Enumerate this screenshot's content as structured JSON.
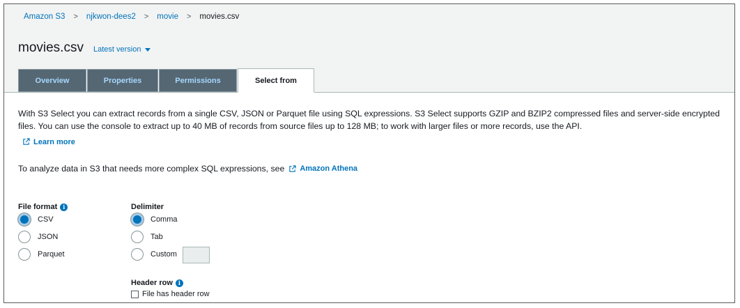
{
  "breadcrumb": {
    "items": [
      "Amazon S3",
      "njkwon-dees2",
      "movie"
    ],
    "current": "movies.csv",
    "separator": ">"
  },
  "title": "movies.csv",
  "version_dropdown": "Latest version",
  "tabs": [
    {
      "label": "Overview",
      "active": false
    },
    {
      "label": "Properties",
      "active": false
    },
    {
      "label": "Permissions",
      "active": false
    },
    {
      "label": "Select from",
      "active": true
    }
  ],
  "description": "With S3 Select you can extract records from a single CSV, JSON or Parquet file using SQL expressions. S3 Select supports GZIP and BZIP2 compressed files and server-side encrypted files. You can use the console to extract up to 40 MB of records from source files up to 128 MB; to work with larger files or more records, use the API.",
  "learn_more": "Learn more",
  "athena_text": "To analyze data in S3 that needs more complex SQL expressions, see",
  "athena_link": "Amazon Athena",
  "file_format": {
    "label": "File format",
    "options": [
      "CSV",
      "JSON",
      "Parquet"
    ],
    "selected": "CSV"
  },
  "delimiter": {
    "label": "Delimiter",
    "options": [
      "Comma",
      "Tab",
      "Custom"
    ],
    "selected": "Comma"
  },
  "header_row": {
    "label": "Header row",
    "checkbox_label": "File has header row",
    "checked": false
  },
  "colors": {
    "link": "#0073bb",
    "tab_bg": "#556773",
    "header_bg": "#f2f3f3"
  }
}
